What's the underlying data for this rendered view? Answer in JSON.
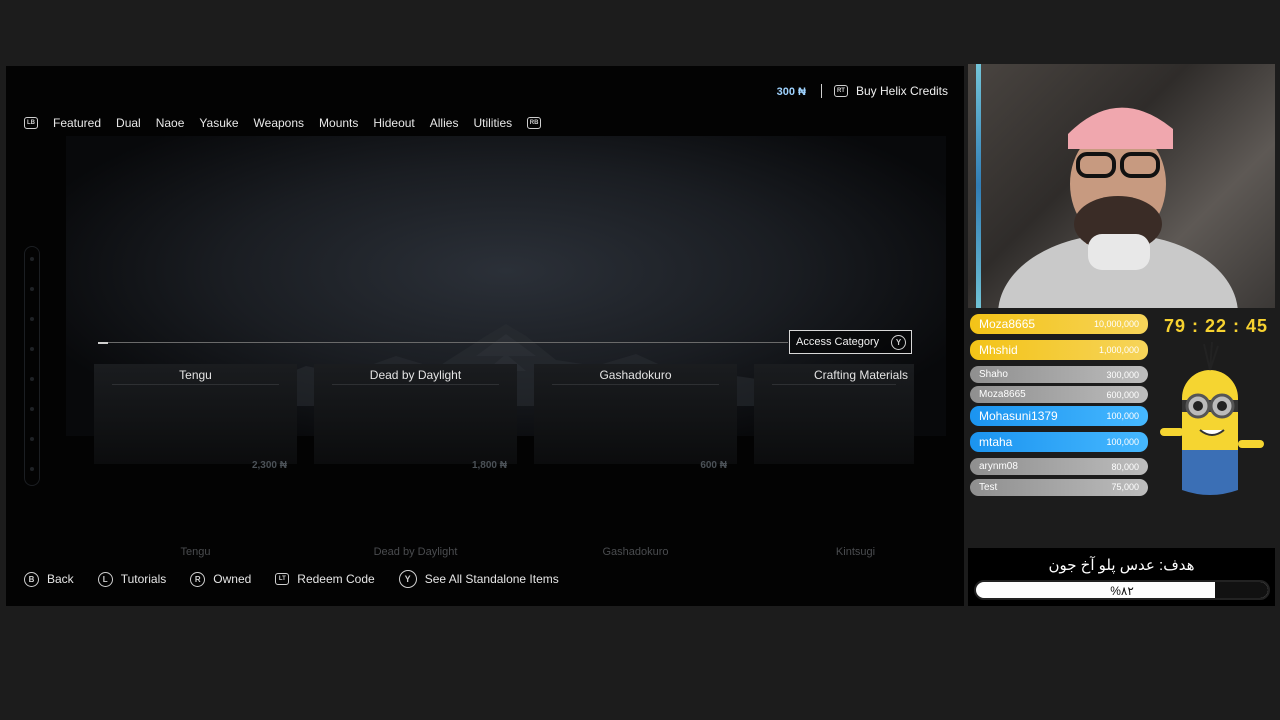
{
  "store": {
    "credits_amount": "300 ₦",
    "buy_credits_label": "Buy Helix Credits",
    "buy_credits_button": "RT",
    "nav_left_button": "LB",
    "nav_right_button": "RB",
    "tabs": [
      "Featured",
      "Dual",
      "Naoe",
      "Yasuke",
      "Weapons",
      "Mounts",
      "Hideout",
      "Allies",
      "Utilities"
    ],
    "access_category_label": "Access Category",
    "access_category_button": "Y",
    "cards": [
      {
        "title": "Tengu",
        "price": "2,300 ₦"
      },
      {
        "title": "Dead by Daylight",
        "price": "1,800 ₦"
      },
      {
        "title": "Gashadokuro",
        "price": "600 ₦"
      },
      {
        "title": "Crafting Materials",
        "price": ""
      }
    ],
    "ghost_row": [
      "Tengu",
      "Dead by Daylight",
      "Gashadokuro",
      "Kintsugi"
    ],
    "footer": [
      {
        "button": "B",
        "label": "Back"
      },
      {
        "button": "L",
        "label": "Tutorials"
      },
      {
        "button": "R",
        "label": "Owned"
      },
      {
        "button": "LT",
        "label": "Redeem Code"
      },
      {
        "button": "Y",
        "label": "See All Standalone Items"
      }
    ]
  },
  "overlay": {
    "timer": "79 : 22 : 45",
    "leaderboard": [
      {
        "name": "Moza8665",
        "value": "10,000,000",
        "tier": "gold"
      },
      {
        "name": "Mhshid",
        "value": "1,000,000",
        "tier": "gold"
      },
      {
        "name": "Shaho",
        "value": "300,000",
        "tier": "gray"
      },
      {
        "name": "Moza8665",
        "value": "600,000",
        "tier": "gray"
      },
      {
        "name": "Mohasuni1379",
        "value": "100,000",
        "tier": "blue"
      },
      {
        "name": "mtaha",
        "value": "100,000",
        "tier": "blue"
      },
      {
        "name": "arynm08",
        "value": "80,000",
        "tier": "gray"
      },
      {
        "name": "Test",
        "value": "75,000",
        "tier": "gray"
      }
    ],
    "goal_title": "هدف: عدس پلو آخ جون",
    "goal_percent_label": "%۸۲",
    "goal_progress": 0.82
  },
  "colors": {
    "credits_accent": "#9fd3ff",
    "timer": "#f7d230",
    "gold": "#f3c317",
    "blue": "#1b94f0",
    "gray": "#a8a8a8"
  }
}
